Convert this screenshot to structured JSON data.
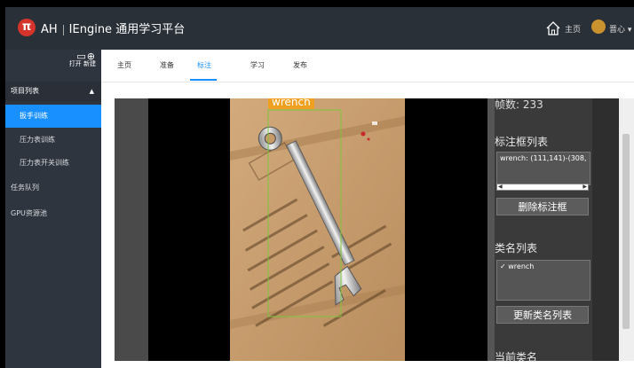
{
  "header": {
    "logo_glyph": "π",
    "brand_short": "AH",
    "brand_engine": "IEngine",
    "brand_title": "通用学习平台",
    "home_label": "主页",
    "user_label": "晋心"
  },
  "sidebar": {
    "action_open": "打开",
    "action_new": "新建",
    "section_label": "项目列表",
    "items": [
      {
        "label": "扳手训练"
      },
      {
        "label": "压力表训练"
      },
      {
        "label": "压力表开关训练"
      }
    ],
    "task_queue": "任务队列",
    "gpu_pool": "GPU资源池"
  },
  "tabs": [
    {
      "label": "主页"
    },
    {
      "label": "准备"
    },
    {
      "label": "标注"
    },
    {
      "label": "学习"
    },
    {
      "label": "发布"
    }
  ],
  "annotator": {
    "frame_count_label": "帧数: 233",
    "bbox_list_title": "标注框列表",
    "bbox_entries": [
      "wrench: (111,141)-(308,"
    ],
    "delete_bbox_button": "删除标注框",
    "class_list_title": "类名列表",
    "class_entries": [
      "✓ wrench"
    ],
    "update_class_button": "更新类名列表",
    "current_class_title": "当前类名",
    "bbox_label": "wrench"
  },
  "colors": {
    "accent": "#1890ff",
    "bbox": "#7cc63a",
    "label_bg": "#f0a020",
    "header_bg": "#2a3038",
    "sidebar_bg": "#2f353e"
  }
}
